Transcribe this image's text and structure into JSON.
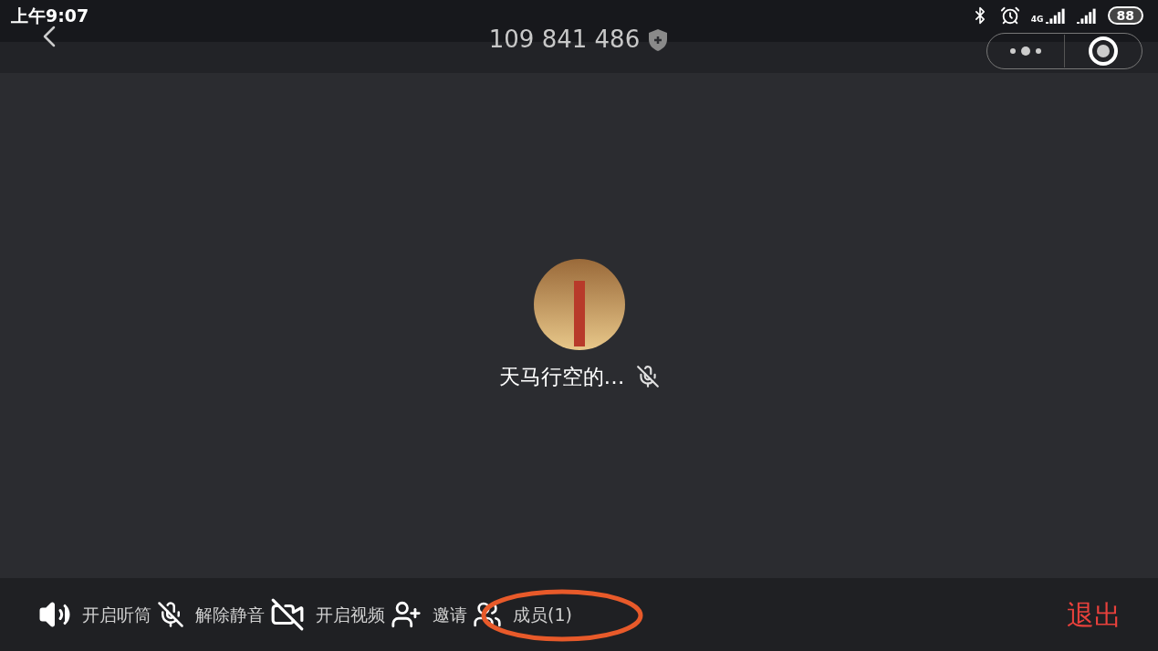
{
  "status_bar": {
    "time": "上午9:07",
    "network": "4G",
    "battery": "88"
  },
  "header": {
    "meeting_id": "109 841 486"
  },
  "participant": {
    "name": "天马行空的…",
    "muted": true
  },
  "toolbar": {
    "items": [
      {
        "kind": "speaker",
        "label": "开启听筒"
      },
      {
        "kind": "mic_off",
        "label": "解除静音"
      },
      {
        "kind": "video_off",
        "label": "开启视频"
      },
      {
        "kind": "invite",
        "label": "邀请"
      },
      {
        "kind": "members",
        "label": "成员(1)"
      }
    ],
    "exit": "退出"
  }
}
